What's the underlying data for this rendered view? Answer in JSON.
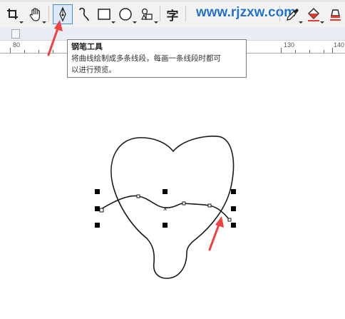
{
  "toolbar": {
    "tools": [
      {
        "name": "crop-tool",
        "icon": "crop-icon"
      },
      {
        "name": "pan-tool",
        "icon": "hand-icon"
      },
      {
        "name": "pen-tool",
        "icon": "pen-nib-icon",
        "active": true
      },
      {
        "name": "bezier-tool",
        "icon": "bezier-curve-icon"
      },
      {
        "name": "rectangle-tool",
        "icon": "rectangle-icon"
      },
      {
        "name": "ellipse-tool",
        "icon": "ellipse-icon"
      },
      {
        "name": "polygon-tool",
        "icon": "shapes-icon"
      },
      {
        "name": "text-tool",
        "icon": "text-icon",
        "label": "字"
      },
      {
        "name": "eyedropper-tool",
        "icon": "eyedropper-icon"
      },
      {
        "name": "fill-tool",
        "icon": "paint-bucket-icon"
      },
      {
        "name": "eraser-tool",
        "icon": "eraser-icon"
      }
    ],
    "watermark": "www.rjzxw.com"
  },
  "ruler": {
    "labels": [
      "80",
      "130",
      "140"
    ]
  },
  "tooltip": {
    "title": "钢笔工具",
    "line1": "将曲线绘制成多条线段，每画一条线段时都可",
    "line2": "以进行预览。"
  },
  "colors": {
    "active_tool_border": "#4a8fd8",
    "annotation_arrow": "#f04040",
    "watermark": "#1f6fd6"
  }
}
